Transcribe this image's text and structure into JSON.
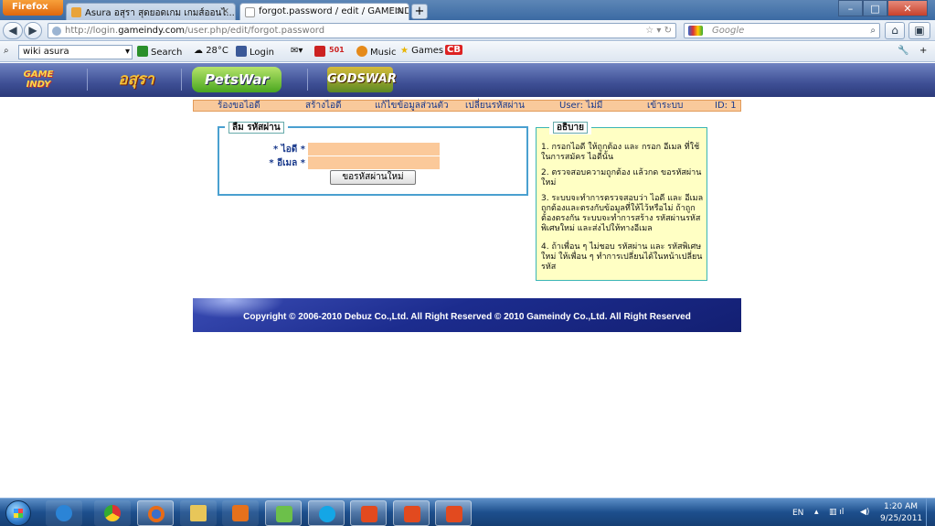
{
  "browser": {
    "app_button": "Firefox",
    "tabs": [
      {
        "title": "Asura อสุรา สุดยอดเกม เกมส์ออนไ...",
        "active": false
      },
      {
        "title": "forgot.password / edit / GAMEINDY",
        "active": true
      }
    ],
    "new_tab": "+",
    "url_prefix": "http://login.",
    "url_domain": "gameindy.com",
    "url_path": "/user.php/edit/forgot.password",
    "search_placeholder": "Google",
    "toolbar": {
      "search_box_value": "wiki asura",
      "search_label": "Search",
      "weather": "28°C",
      "login_label": "Login",
      "music_label": "Music",
      "games_label": "Games",
      "badge_501": "501",
      "cb_label": "CB"
    }
  },
  "site": {
    "logos": {
      "gameindy": "GAME INDY",
      "asura": "อสุรา",
      "petswar": "PetsWar",
      "godswar": "GODSWAR"
    },
    "menu": [
      "ร้องขอไอดี",
      "สร้างไอดี",
      "แก้ไขข้อมูลส่วนตัว",
      "เปลี่ยนรหัสผ่าน",
      "User: ไม่มี",
      "เข้าระบบ",
      "ID: 1"
    ],
    "form": {
      "legend": "ลืม รหัสผ่าน",
      "id_label": "* ไอดี *",
      "email_label": "* อีเมล *",
      "id_value": "",
      "email_value": "",
      "submit_label": "ขอรหัสผ่านใหม่"
    },
    "help": {
      "legend": "อธิบาย",
      "items": [
        "1. กรอกไอดี ให้ถูกต้อง และ กรอก อีเมล ที่ใช้ในการสมัคร ไอดีนั้น",
        "2. ตรวจสอบความถูกต้อง แล้วกด ขอรหัสผ่านใหม่",
        "3. ระบบจะทำการตรวจสอบว่า ไอดี และ อีเมล ถูกต้องและตรงกับข้อมูลที่ให้ไว้หรือไม่ ถ้าถูกต้องตรงกัน ระบบจะทำการสร้าง รหัสผ่านรหัสพิเศษใหม่ และส่งไปให้ทางอีเมล",
        "4. ถ้าเพื่อน ๆ ไม่ชอบ รหัสผ่าน และ รหัสพิเศษใหม่ ให้เพื่อน ๆ ทำการเปลี่ยนได้ในหน้าเปลี่ยนรหัส"
      ]
    },
    "footer": "Copyright © 2006-2010 Debuz Co.,Ltd. All Right Reserved © 2010 Gameindy Co.,Ltd. All Right Reserved"
  },
  "taskbar": {
    "language": "EN",
    "time": "1:20 AM",
    "date": "9/25/2011"
  },
  "colors": {
    "menu_bg": "#f9c99b",
    "field_bg": "#fbc99a",
    "help_bg": "#ffffc4",
    "fieldset_border": "#4aa0d0",
    "footer_bg": "#1c2c8e"
  }
}
